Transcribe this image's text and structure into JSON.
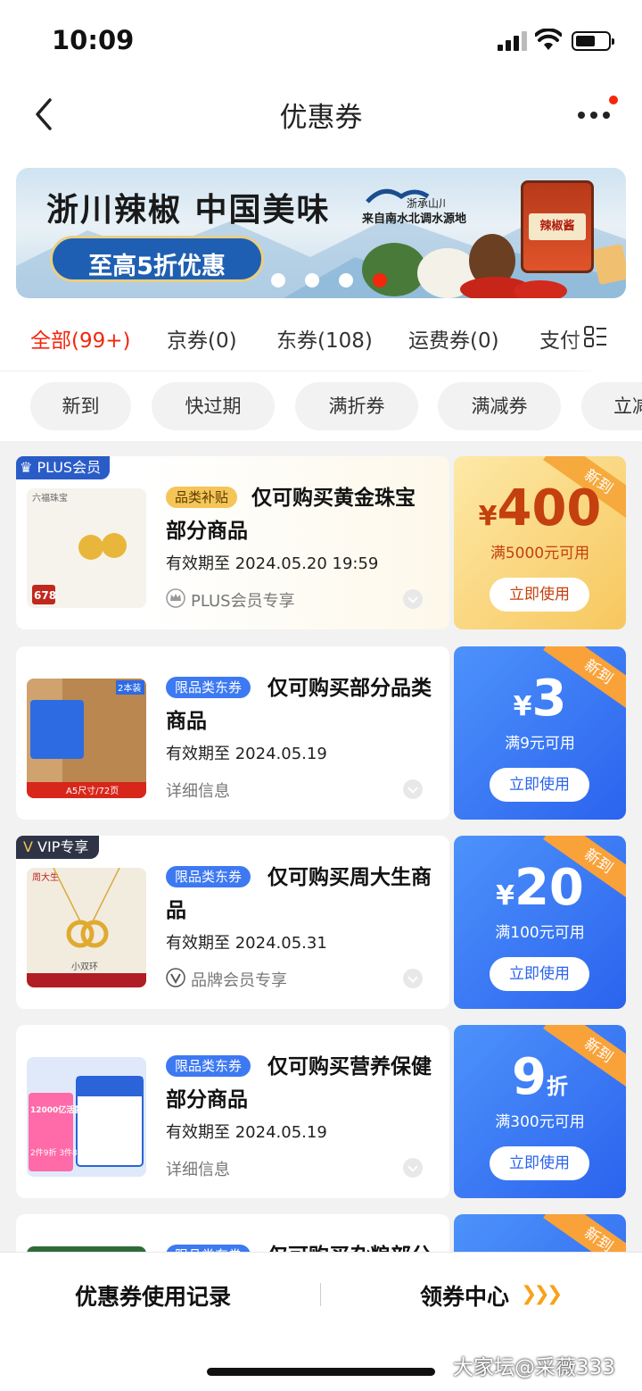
{
  "status": {
    "time": "10:09"
  },
  "header": {
    "title": "优惠券"
  },
  "banner": {
    "headline": "浙川辣椒 中国美味",
    "promo": "至高5折优惠",
    "brand": "浙承山川",
    "subline": "来自南水北调水源地",
    "jar_label": "辣椒酱",
    "active_dot": 4
  },
  "tabs": [
    {
      "label": "全部(99+)",
      "active": true
    },
    {
      "label": "京券(0)"
    },
    {
      "label": "东券(108)"
    },
    {
      "label": "运费券(0)"
    },
    {
      "label": "支付"
    }
  ],
  "chips": [
    "新到",
    "快过期",
    "满折券",
    "满减券",
    "立减券"
  ],
  "coupons": [
    {
      "badge": "PLUS会员",
      "tag": "品类补贴",
      "title": "仅可购买黄金珠宝部分商品",
      "expiry": "有效期至 2024.05.20 19:59",
      "footer": "PLUS会员专享",
      "currency": "¥",
      "amount": "400",
      "unit": "",
      "condition": "满5000元可用",
      "button": "立即使用",
      "ribbon": "新到",
      "thumb_text": {
        "brand": "六福珠宝",
        "price": "678"
      }
    },
    {
      "badge": "",
      "tag": "限品类东券",
      "title": "仅可购买部分品类商品",
      "expiry": "有效期至 2024.05.19",
      "footer": "详细信息",
      "currency": "¥",
      "amount": "3",
      "unit": "",
      "condition": "满9元可用",
      "button": "立即使用",
      "ribbon": "新到",
      "thumb_text": {
        "brand": "2本装",
        "price": "A5尺寸/72页"
      }
    },
    {
      "badge": "VIP专享",
      "tag": "限品类东券",
      "title": "仅可购买周大生商品",
      "expiry": "有效期至 2024.05.31",
      "footer": "品牌会员专享",
      "currency": "¥",
      "amount": "20",
      "unit": "",
      "condition": "满100元可用",
      "button": "立即使用",
      "ribbon": "新到",
      "thumb_text": {
        "brand": "周大生",
        "price": "小双环"
      }
    },
    {
      "badge": "",
      "tag": "限品类东券",
      "title": "仅可购买营养保健部分商品",
      "expiry": "有效期至 2024.05.19",
      "footer": "详细信息",
      "currency": "",
      "amount": "9",
      "unit": "折",
      "condition": "满300元可用",
      "button": "立即使用",
      "ribbon": "新到",
      "thumb_text": {
        "brand": "12000亿活菌",
        "price": "2件9折 3件8折"
      }
    },
    {
      "badge": "",
      "tag": "限品类东券",
      "title": "仅可购买杂粮部分商品",
      "expiry": "",
      "footer": "",
      "currency": "",
      "amount": "",
      "unit": "",
      "condition": "",
      "button": "",
      "ribbon": "新到",
      "thumb_text": {
        "brand": "",
        "price": ""
      }
    }
  ],
  "bottom": {
    "left": "优惠券使用记录",
    "right": "领券中心"
  },
  "watermark": "大家坛@采薇333",
  "colors": {
    "accent": "#f2270c",
    "blue": "#2b63ee",
    "gold": "#f7c75e",
    "tag_blue": "#3d79f2"
  }
}
